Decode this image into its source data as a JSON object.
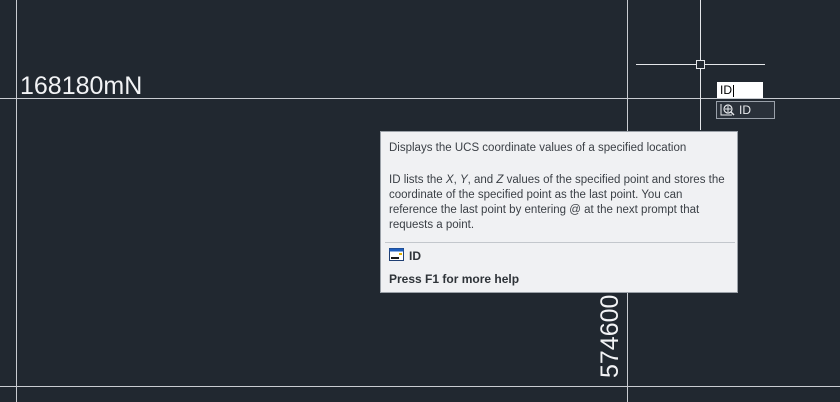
{
  "canvas": {
    "northing_label": "168180mN",
    "easting_label": "574600"
  },
  "command_line": {
    "value": "ID"
  },
  "autocomplete": {
    "item_label": "ID",
    "item_icon": "locate-point-icon"
  },
  "tooltip": {
    "title": "Displays the UCS coordinate values of a specified location",
    "body_prefix": "ID lists the ",
    "body_x": "X",
    "body_sep1": ", ",
    "body_y": "Y",
    "body_sep2": ", and ",
    "body_z": "Z",
    "body_rest": " values of the specified point and stores the coordinate of the specified point as the last point. You can reference the last point by entering @ at the next prompt that requests a point.",
    "command_name": "ID",
    "command_icon": "command-window-icon",
    "help_text": "Press F1 for more help"
  },
  "colors": {
    "background": "#212830",
    "grid": "#c9ccd1",
    "tooltip_bg": "#f0f1f3"
  }
}
